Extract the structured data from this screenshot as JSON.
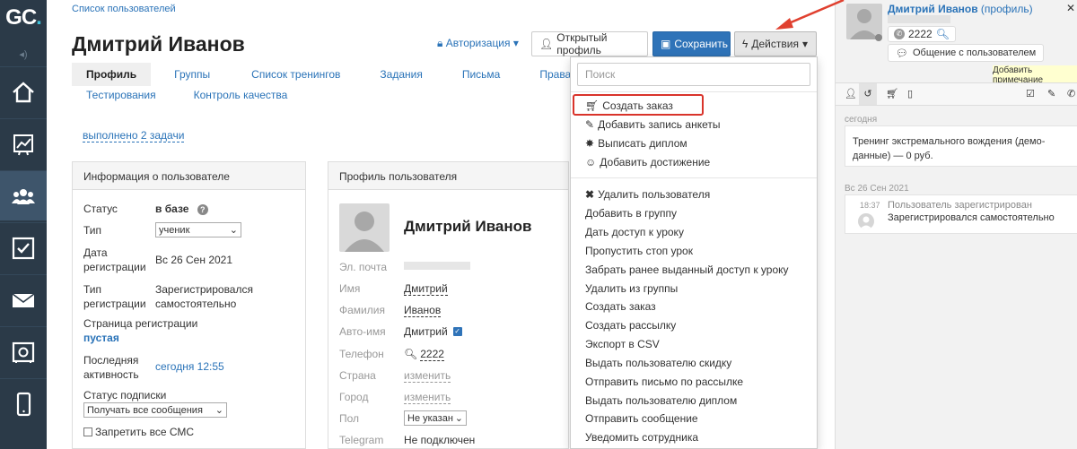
{
  "logo": {
    "text": "GC",
    "dot": "."
  },
  "breadcrumb": "Список пользователей",
  "page_title": "Дмитрий Иванов",
  "header": {
    "auth_label": "Авторизация",
    "open_profile_label": "Открытый профиль",
    "save_label": "Сохранить",
    "actions_label": "Действия"
  },
  "tabs_row1": [
    "Профиль",
    "Группы",
    "Список тренингов",
    "Задания",
    "Письма",
    "Права"
  ],
  "tabs_row2": [
    "Тестирования",
    "Контроль качества"
  ],
  "done_tasks_link": "выполнено 2 задачи",
  "info_panel": {
    "title": "Информация о пользователе",
    "status_label": "Статус",
    "status_value": "в базе",
    "type_label": "Тип",
    "type_value": "ученик",
    "reg_date_label_1": "Дата",
    "reg_date_label_2": "регистрации",
    "reg_date_value": "Вс 26 Сен 2021",
    "reg_type_label_1": "Тип",
    "reg_type_label_2": "регистрации",
    "reg_type_value_1": "Зарегистрировался",
    "reg_type_value_2": "самостоятельно",
    "reg_page_label": "Страница регистрации",
    "reg_page_value": "пустая",
    "last_activity_label_1": "Последняя",
    "last_activity_label_2": "активность",
    "last_activity_value": "сегодня 12:55",
    "subscription_label": "Статус подписки",
    "subscription_value": "Получать все сообщения",
    "sms_label": "Запретить все СМС"
  },
  "profile_panel": {
    "title": "Профиль пользователя",
    "name": "Дмитрий Иванов",
    "email_label": "Эл. почта",
    "first_name_label": "Имя",
    "first_name_value": "Дмитрий",
    "last_name_label": "Фамилия",
    "last_name_value": "Иванов",
    "autoname_label": "Авто-имя",
    "autoname_value": "Дмитрий",
    "phone_label": "Телефон",
    "phone_value": "2222",
    "country_label": "Страна",
    "country_value": "изменить",
    "city_label": "Город",
    "city_value": "изменить",
    "gender_label": "Пол",
    "gender_value": "Не указан",
    "telegram_label": "Telegram",
    "telegram_value": "Не подключен"
  },
  "actions_menu": {
    "search_placeholder": "Поиск",
    "group1": [
      "Создать заказ",
      "Добавить запись анкеты",
      "Выписать диплом",
      "Добавить достижение"
    ],
    "group2": [
      "Удалить пользователя",
      "Добавить в группу",
      "Дать доступ к уроку",
      "Пропустить стоп урок",
      "Забрать ранее выданный доступ к уроку",
      "Удалить из группы",
      "Создать заказ",
      "Создать рассылку",
      "Экспорт в CSV",
      "Выдать пользователю скидку",
      "Отправить письмо по рассылке",
      "Выдать пользователю диплом",
      "Отправить сообщение",
      "Уведомить сотрудника"
    ]
  },
  "sidebar": {
    "user_name": "Дмитрий Иванов",
    "profile_link": "(профиль)",
    "phone": "2222",
    "chat_button": "Общение с пользователем",
    "add_note": "Добавить примечание",
    "date_today": "сегодня",
    "event1_text": "Тренинг экстремального вождения (демо-данные) — 0 руб.",
    "date_reg": "Вс 26 Сен 2021",
    "event2_time": "18:37",
    "event2_title": "Пользователь зарегистрирован",
    "event2_text": "Зарегистрировался самостоятельно"
  },
  "colors": {
    "accent": "#2a73b8",
    "nav_bg": "#2b3a48",
    "save_bg": "#2f73b8",
    "highlight": "#d9342b",
    "arrow": "#e0402f"
  }
}
